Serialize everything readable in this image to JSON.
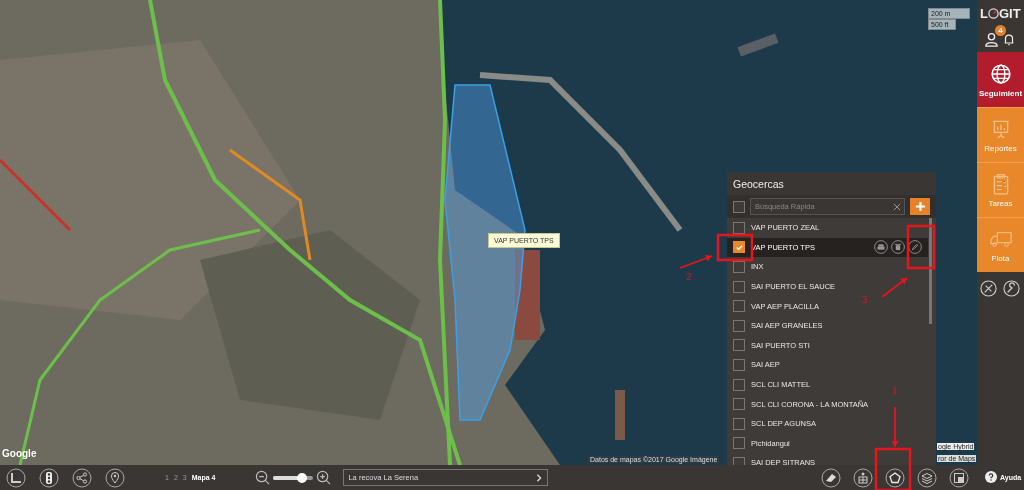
{
  "map": {
    "tooltip": "VAP PUERTO TPS",
    "scale": [
      "200 m",
      "500 ft"
    ],
    "logo": "Google",
    "attribution": "Datos de mapas ©2017 Google Imágene",
    "map_type": "ogle Hybrid",
    "error_link": "ror de Maps"
  },
  "geofence_panel": {
    "title": "Geocercas",
    "all_checked": false,
    "search": {
      "placeholder": "Búsqueda Rápida"
    },
    "items": [
      {
        "label": "VAP PUERTO ZEAL",
        "checked": false,
        "selected": false
      },
      {
        "label": "VAP PUERTO TPS",
        "checked": true,
        "selected": true
      },
      {
        "label": "INX",
        "checked": false,
        "selected": false
      },
      {
        "label": "SAI PUERTO EL SAUCE",
        "checked": false,
        "selected": false
      },
      {
        "label": "VAP AEP PLACILLA",
        "checked": false,
        "selected": false
      },
      {
        "label": "SAI AEP GRANELES",
        "checked": false,
        "selected": false
      },
      {
        "label": "SAI PUERTO STI",
        "checked": false,
        "selected": false
      },
      {
        "label": "SAI AEP",
        "checked": false,
        "selected": false
      },
      {
        "label": "SCL CLI MATTEL",
        "checked": false,
        "selected": false
      },
      {
        "label": "SCL CLI CORONA - LA MONTAÑA",
        "checked": false,
        "selected": false
      },
      {
        "label": "SCL DEP AGUNSA",
        "checked": false,
        "selected": false
      },
      {
        "label": "Pichidangui",
        "checked": false,
        "selected": false
      },
      {
        "label": "SAI DEP SITRANS",
        "checked": false,
        "selected": false
      }
    ]
  },
  "bottom_bar": {
    "pages": [
      {
        "label": "1",
        "selected": false
      },
      {
        "label": "2",
        "selected": false
      },
      {
        "label": "3",
        "selected": false
      },
      {
        "label": "Mapa 4",
        "selected": true
      }
    ],
    "zoom": {
      "level": 0.72
    },
    "address": "La recova La Serena"
  },
  "sidebar": {
    "logo_left": "L",
    "logo_right": "GIT",
    "notifications": "4",
    "items": [
      {
        "label": "Seguimient",
        "kind": "globe",
        "selected": true
      },
      {
        "label": "Reportes",
        "kind": "chart",
        "selected": false
      },
      {
        "label": "Tareas",
        "kind": "clipboard",
        "selected": false
      },
      {
        "label": "Flota",
        "kind": "truck",
        "selected": false
      }
    ],
    "help": "Ayuda"
  },
  "annotations": [
    {
      "kind": "number",
      "label": "1"
    },
    {
      "kind": "number",
      "label": "2"
    },
    {
      "kind": "number",
      "label": "3"
    },
    {
      "kind": "box"
    },
    {
      "kind": "box"
    },
    {
      "kind": "box"
    },
    {
      "kind": "arrow"
    },
    {
      "kind": "arrow"
    },
    {
      "kind": "arrow"
    }
  ]
}
